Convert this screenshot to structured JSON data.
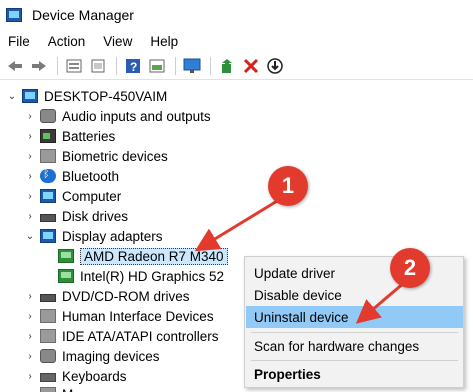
{
  "window": {
    "title": "Device Manager"
  },
  "menu": [
    "File",
    "Action",
    "View",
    "Help"
  ],
  "toolbar_icons": [
    "back-icon",
    "forward-icon",
    "properties-icon",
    "update-icon",
    "help-icon",
    "show-icon",
    "monitor-icon",
    "scan-icon",
    "uninstall-icon",
    "download-icon"
  ],
  "tree": {
    "root": "DESKTOP-450VAIM",
    "items": [
      {
        "label": "Audio inputs and outputs",
        "icon": "speaker-icon"
      },
      {
        "label": "Batteries",
        "icon": "battery-icon"
      },
      {
        "label": "Biometric devices",
        "icon": "fingerprint-icon"
      },
      {
        "label": "Bluetooth",
        "icon": "bluetooth-icon"
      },
      {
        "label": "Computer",
        "icon": "computer-icon"
      },
      {
        "label": "Disk drives",
        "icon": "disk-icon"
      },
      {
        "label": "Display adapters",
        "icon": "display-icon"
      },
      {
        "label": "AMD Radeon R7 M340",
        "icon": "gpu-icon"
      },
      {
        "label": "Intel(R) HD Graphics 52",
        "icon": "gpu-icon"
      },
      {
        "label": "DVD/CD-ROM drives",
        "icon": "dvd-icon"
      },
      {
        "label": "Human Interface Devices",
        "icon": "hid-icon"
      },
      {
        "label": "IDE ATA/ATAPI controllers",
        "icon": "ide-icon"
      },
      {
        "label": "Imaging devices",
        "icon": "camera-icon"
      },
      {
        "label": "Keyboards",
        "icon": "keyboard-icon"
      },
      {
        "label": "M",
        "icon": "mouse-icon"
      }
    ]
  },
  "context_menu": {
    "items": [
      "Update driver",
      "Disable device",
      "Uninstall device",
      "Scan for hardware changes",
      "Properties"
    ]
  },
  "annotations": {
    "badge1": "1",
    "badge2": "2"
  },
  "colors": {
    "badge": "#e23b2e",
    "highlight": "#91c9f7",
    "selected": "#cce8ff"
  }
}
